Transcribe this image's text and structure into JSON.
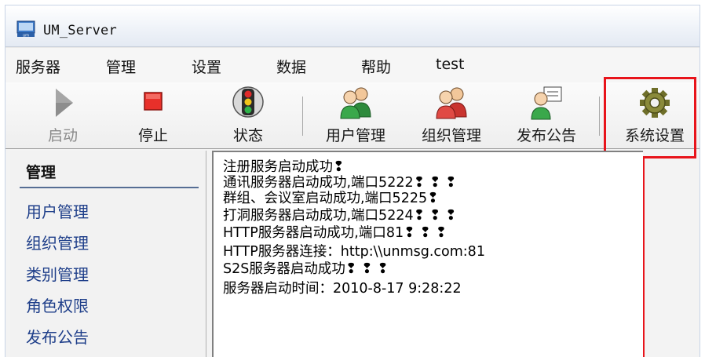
{
  "window": {
    "title": "UM_Server"
  },
  "menu": {
    "items": [
      "服务器",
      "管理",
      "设置",
      "数据",
      "帮助",
      "test"
    ]
  },
  "toolbar": {
    "buttons": [
      {
        "label": "启动",
        "icon": "play-icon",
        "enabled": false
      },
      {
        "label": "停止",
        "icon": "stop-icon",
        "enabled": true
      },
      {
        "label": "状态",
        "icon": "traffic-light-icon",
        "enabled": true
      },
      {
        "label": "用户管理",
        "icon": "user-group-icon",
        "enabled": true
      },
      {
        "label": "组织管理",
        "icon": "organization-icon",
        "enabled": true
      },
      {
        "label": "发布公告",
        "icon": "announcement-icon",
        "enabled": true
      },
      {
        "label": "系统设置",
        "icon": "gear-icon",
        "enabled": true
      }
    ]
  },
  "annotation": {
    "highlight_color": "#e8141b",
    "target": "系统设置"
  },
  "sidebar": {
    "header": "管理",
    "items": [
      "用户管理",
      "组织管理",
      "类别管理",
      "角色权限",
      "发布公告"
    ]
  },
  "log": {
    "lines": [
      "注册服务启动成功❢",
      "通讯服务器启动成功,端口5222❢ ❢ ❢",
      "群组、会议室启动成功,端口5225❢",
      "打洞服务器启动成功,端口5224❢ ❢ ❢",
      "HTTP服务器启动成功,端口81❢ ❢ ❢",
      "HTTP服务器连接：http:\\\\unmsg.com:81",
      "S2S服务器启动成功❢ ❢ ❢",
      "服务器启动时间：2010-8-17 9:28:22"
    ]
  }
}
